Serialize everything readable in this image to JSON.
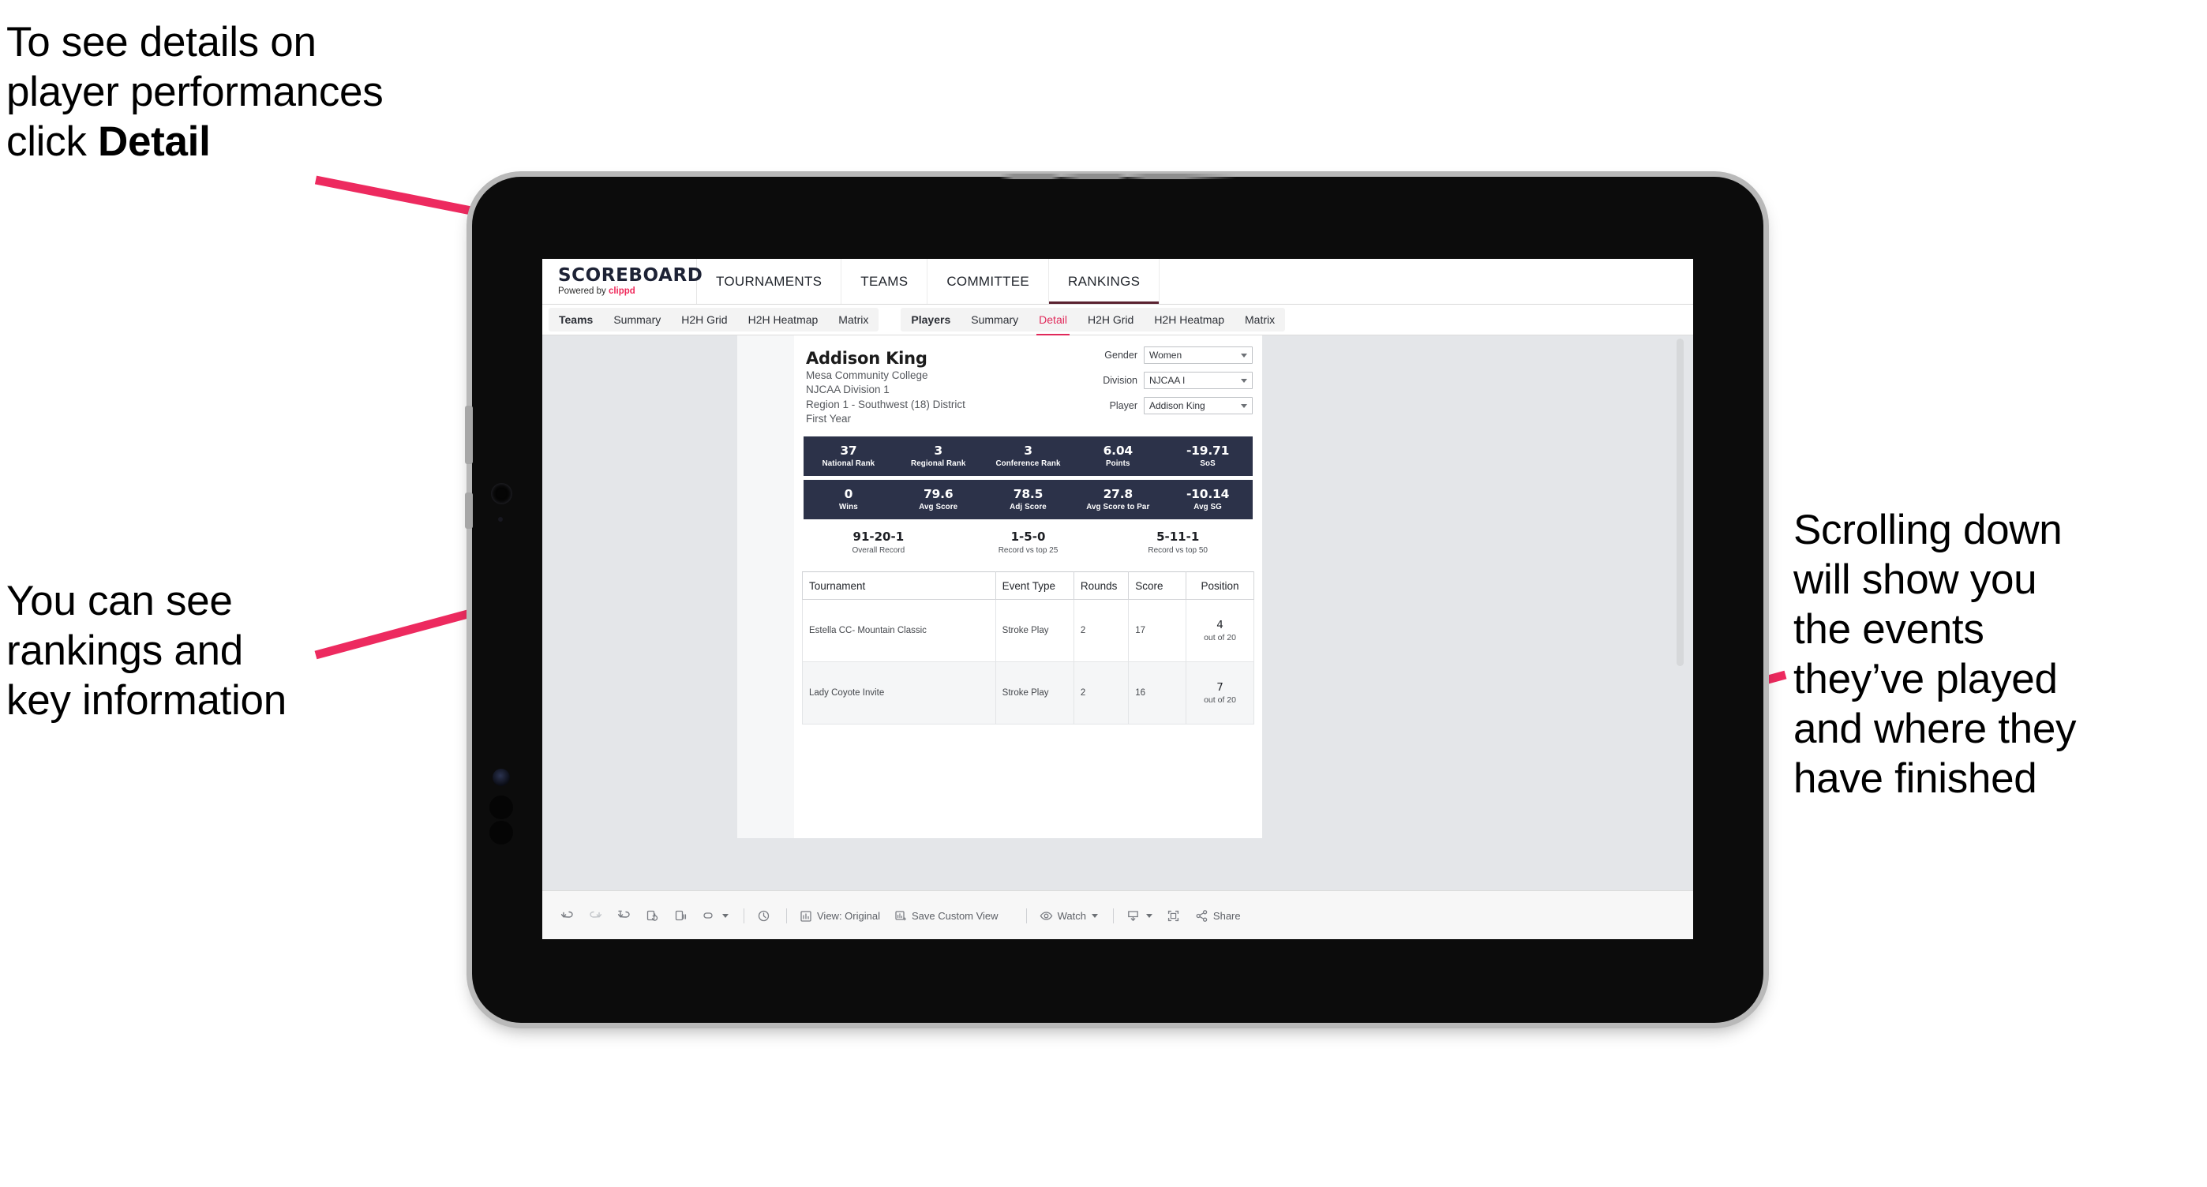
{
  "annotations": {
    "detail": "To see details on\nplayer performances\nclick ",
    "detail_bold": "Detail",
    "rankings": "You can see\nrankings and\nkey information",
    "scrolling": "Scrolling down\nwill show you\nthe events\nthey’ve played\nand where they\nhave finished",
    "arrow_color": "#ed2a5f"
  },
  "app": {
    "brand": {
      "title": "SCOREBOARD",
      "powered_prefix": "Powered by ",
      "powered_brand": "clippd",
      "brand_accent": "#ef2a5b"
    },
    "topnav": [
      {
        "label": "TOURNAMENTS",
        "active": false
      },
      {
        "label": "TEAMS",
        "active": false
      },
      {
        "label": "COMMITTEE",
        "active": false
      },
      {
        "label": "RANKINGS",
        "active": true
      }
    ],
    "subnav_group_teams": [
      {
        "label": "Teams",
        "bold": true,
        "active": false
      },
      {
        "label": "Summary",
        "bold": false,
        "active": false
      },
      {
        "label": "H2H Grid",
        "bold": false,
        "active": false
      },
      {
        "label": "H2H Heatmap",
        "bold": false,
        "active": false
      },
      {
        "label": "Matrix",
        "bold": false,
        "active": false
      }
    ],
    "subnav_group_players": [
      {
        "label": "Players",
        "bold": true,
        "active": false
      },
      {
        "label": "Summary",
        "bold": false,
        "active": false
      },
      {
        "label": "Detail",
        "bold": false,
        "active": true
      },
      {
        "label": "H2H Grid",
        "bold": false,
        "active": false
      },
      {
        "label": "H2H Heatmap",
        "bold": false,
        "active": false
      },
      {
        "label": "Matrix",
        "bold": false,
        "active": false
      }
    ],
    "accent_active": "#e0295a"
  },
  "player": {
    "name": "Addison King",
    "school": "Mesa Community College",
    "division": "NJCAA Division 1",
    "region": "Region 1 - Southwest (18) District",
    "year": "First Year"
  },
  "filters": [
    {
      "label": "Gender",
      "value": "Women"
    },
    {
      "label": "Division",
      "value": "NJCAA I"
    },
    {
      "label": "Player",
      "value": "Addison King"
    }
  ],
  "stat_bands": {
    "band_color": "#2c3249",
    "row1": [
      {
        "value": "37",
        "label": "National Rank"
      },
      {
        "value": "3",
        "label": "Regional Rank"
      },
      {
        "value": "3",
        "label": "Conference Rank"
      },
      {
        "value": "6.04",
        "label": "Points"
      },
      {
        "value": "-19.71",
        "label": "SoS"
      }
    ],
    "row2": [
      {
        "value": "0",
        "label": "Wins"
      },
      {
        "value": "79.6",
        "label": "Avg Score"
      },
      {
        "value": "78.5",
        "label": "Adj Score"
      },
      {
        "value": "27.8",
        "label": "Avg Score to Par"
      },
      {
        "value": "-10.14",
        "label": "Avg SG"
      }
    ]
  },
  "records": [
    {
      "value": "91-20-1",
      "label": "Overall Record"
    },
    {
      "value": "1-5-0",
      "label": "Record vs top 25"
    },
    {
      "value": "5-11-1",
      "label": "Record vs top 50"
    }
  ],
  "events_table": {
    "columns": [
      "Tournament",
      "Event Type",
      "Rounds",
      "Score",
      "Position"
    ],
    "rows": [
      {
        "tournament": "Estella CC- Mountain Classic",
        "event_type": "Stroke Play",
        "rounds": "2",
        "score": "17",
        "position": "4",
        "position_sub": "out of 20"
      },
      {
        "tournament": "Lady Coyote Invite",
        "event_type": "Stroke Play",
        "rounds": "2",
        "score": "16",
        "position": "7",
        "position_sub": "out of 20"
      }
    ]
  },
  "bottom_toolbar": {
    "undo": "undo-icon",
    "redo": "redo-icon",
    "revert": "revert-icon",
    "refresh": "refresh-data-icon",
    "pause": "pause-updates-icon",
    "highlight": "highlight-icon",
    "clock": "clock-icon",
    "view_label": "View: Original",
    "save_view_label": "Save Custom View",
    "watch_label": "Watch",
    "download": "download-icon",
    "fullscreen": "fullscreen-icon",
    "share_label": "Share"
  }
}
